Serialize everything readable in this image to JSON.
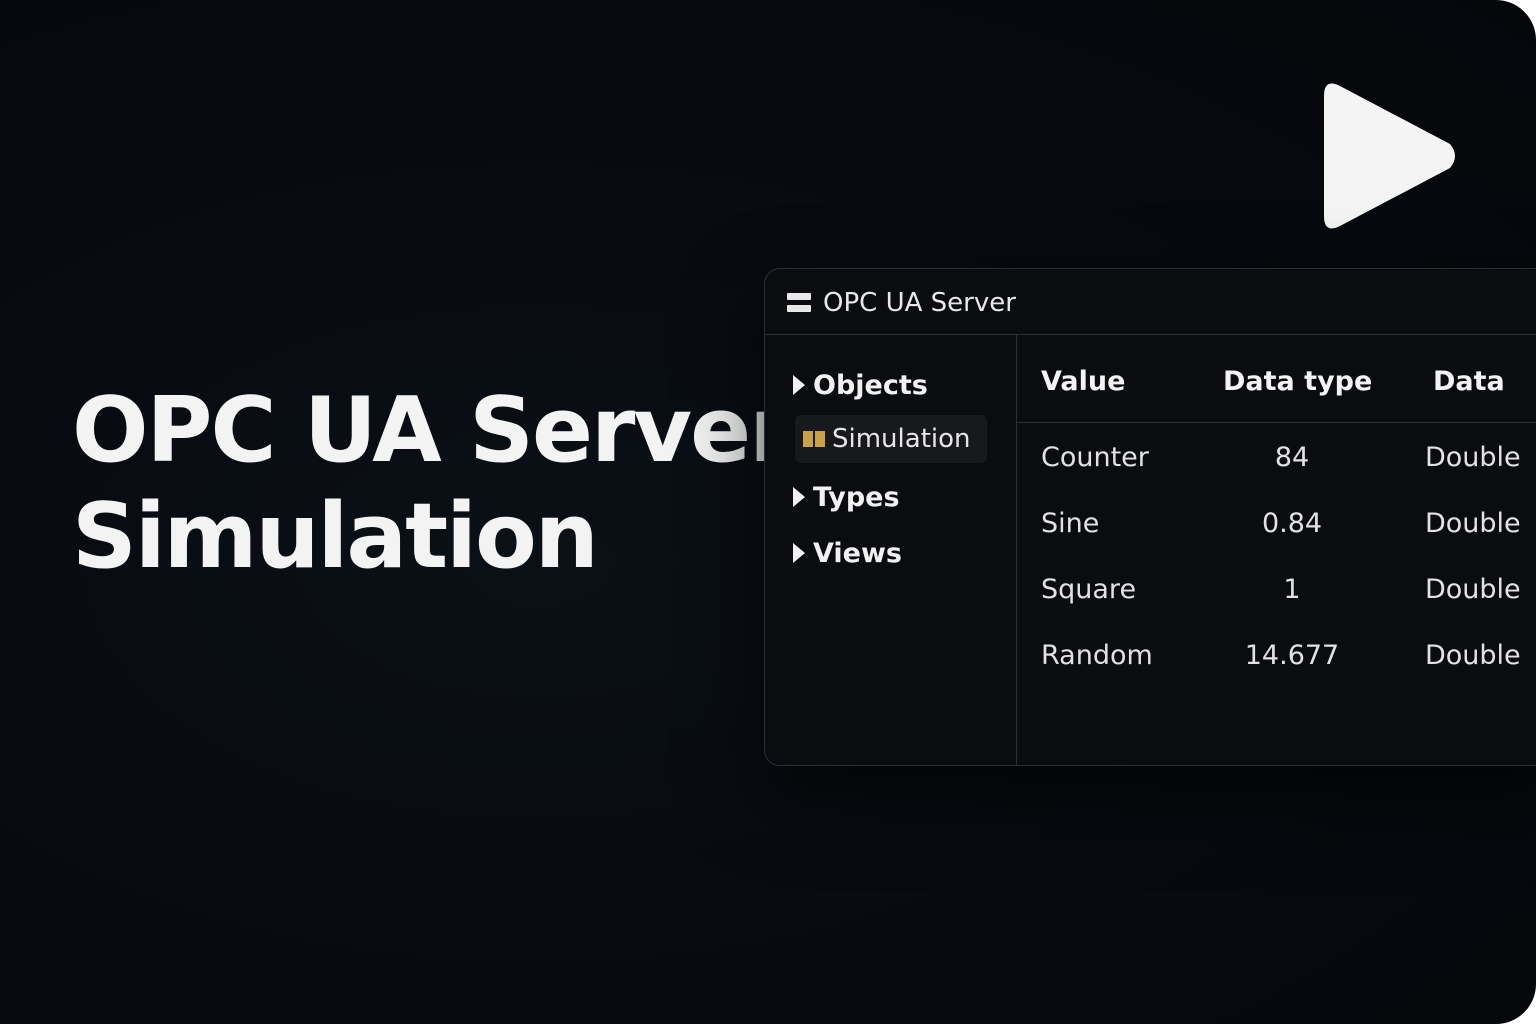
{
  "headline": {
    "line1": "OPC UA Server",
    "line2": "Simulation"
  },
  "play_button": {
    "icon": "play-icon"
  },
  "window": {
    "title": "OPC UA Server",
    "menu_icon": "menu-icon",
    "tree": {
      "objects": "Objects",
      "simulation": "Simulation",
      "types": "Types",
      "views": "Views"
    },
    "table": {
      "columns": [
        "Value",
        "Data type",
        "Data"
      ],
      "rows": [
        {
          "name": "Counter",
          "value": "84",
          "type": "Double"
        },
        {
          "name": "Sine",
          "value": "0.84",
          "type": "Double"
        },
        {
          "name": "Square",
          "value": "1",
          "type": "Double"
        },
        {
          "name": "Random",
          "value": "14.677",
          "type": "Double"
        }
      ]
    }
  },
  "colors": {
    "background": "#070a0f",
    "text": "#f3f3f3",
    "folder": "#c7a24b",
    "border": "#2b2f36"
  }
}
